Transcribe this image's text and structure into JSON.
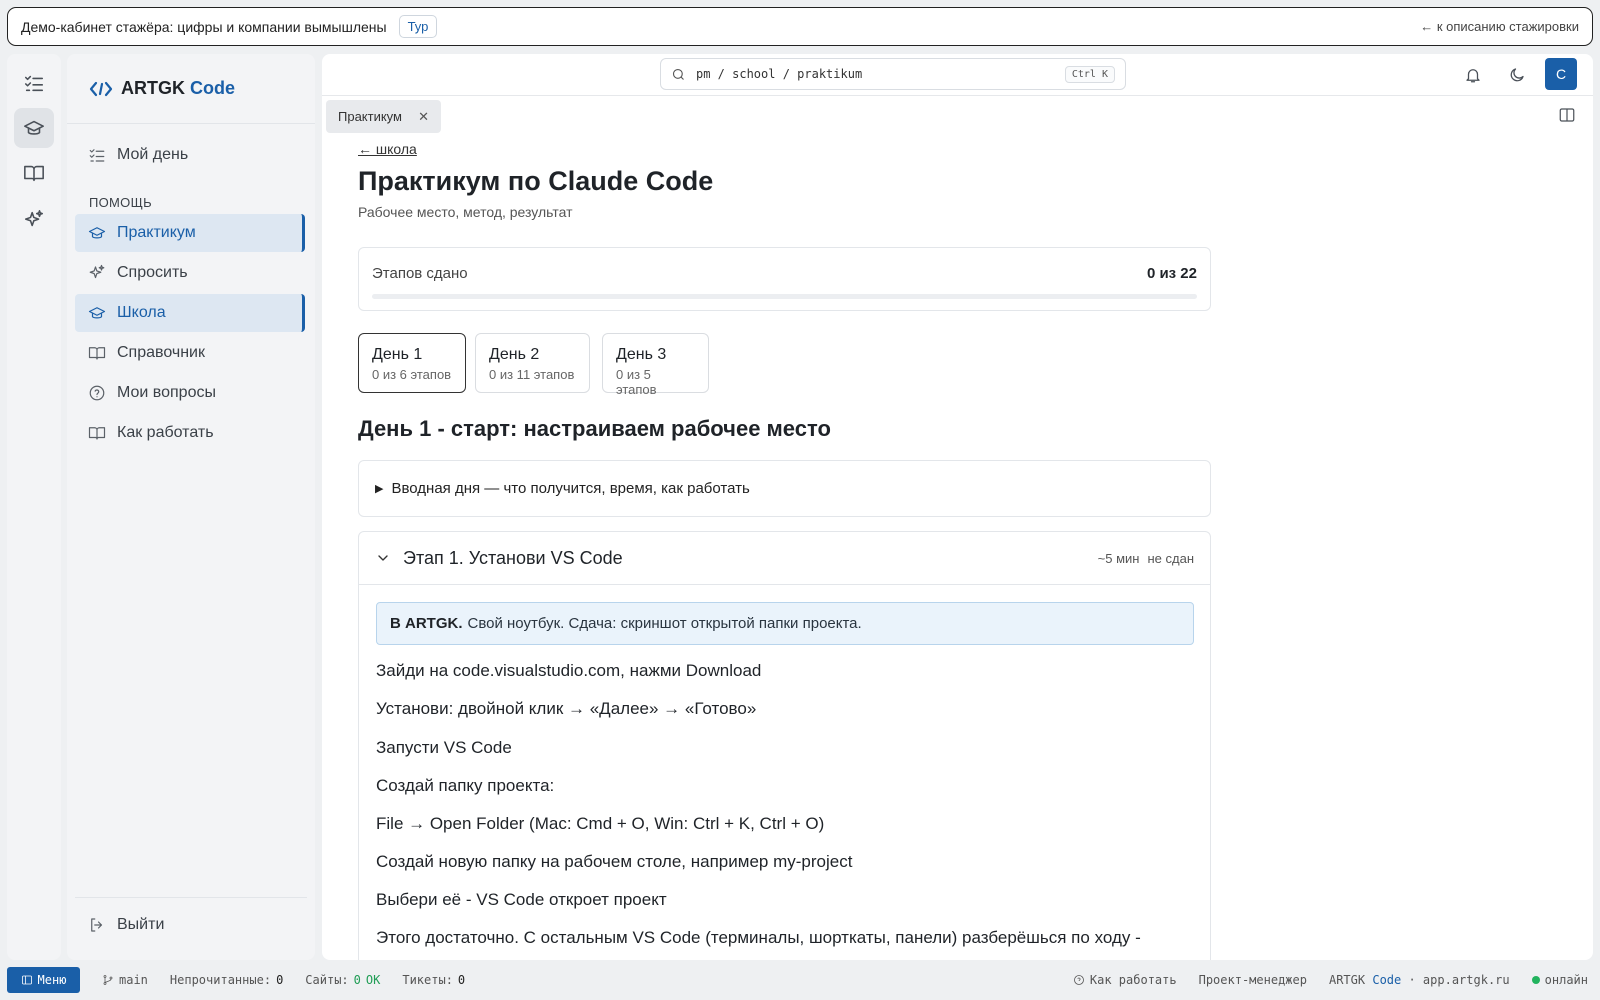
{
  "banner": {
    "text": "Демо-кабинет стажёра: цифры и компании вымышлены",
    "tour_label": "Тур",
    "back_label": "← к описанию стажировки"
  },
  "logo": {
    "name": "ARTGK",
    "accent": "Code"
  },
  "sidebar": {
    "section_label": "ПОМОЩЬ",
    "items": [
      {
        "label": "Мой день",
        "icon": "checklist-icon"
      },
      {
        "label": "Практикум",
        "icon": "graduation-cap-icon",
        "active": true
      },
      {
        "label": "Спросить",
        "icon": "sparkles-icon"
      },
      {
        "label": "Школа",
        "icon": "graduation-cap-icon",
        "active": true
      },
      {
        "label": "Справочник",
        "icon": "book-icon"
      },
      {
        "label": "Мои вопросы",
        "icon": "question-circle-icon"
      },
      {
        "label": "Как работать",
        "icon": "book-icon"
      }
    ],
    "logout_label": "Выйти"
  },
  "topbar": {
    "search_text": "pm / school / praktikum",
    "search_shortcut": "Ctrl K",
    "avatar_letter": "С"
  },
  "tab": {
    "label": "Практикум"
  },
  "page": {
    "back_link": "← школа",
    "title": "Практикум по Claude Code",
    "subtitle": "Рабочее место, метод, результат",
    "progress": {
      "label": "Этапов сдано",
      "value": "0 из 22",
      "fraction": 0
    }
  },
  "days": [
    {
      "title": "День 1",
      "sub": "0 из 6 этапов",
      "active": true
    },
    {
      "title": "День 2",
      "sub": "0 из 11 этапов"
    },
    {
      "title": "День 3",
      "sub": "0 из 5 этапов"
    }
  ],
  "day_heading": "День 1 - старт: настраиваем рабочее место",
  "intro": "Вводная дня — что получится, время, как работать",
  "stage": {
    "title": "Этап 1. Установи VS Code",
    "time": "~5 мин",
    "status": "не сдан",
    "callout_bold": "В ARTGK.",
    "callout_text": "Свой ноутбук. Сдача: скриншот открытой папки проекта.",
    "steps": [
      "Зайди на code.visualstudio.com, нажми Download",
      "Установи: двойной клик → «Далее» → «Готово»",
      "Запусти VS Code",
      "Создай папку проекта:",
      "File → Open Folder (Mac: Cmd + O, Win: Ctrl + K, Ctrl + O)",
      "Создай новую папку на рабочем столе, например my-project",
      "Выбери её - VS Code откроет проект",
      "Этого достаточно. С остальным VS Code (терминалы, шорткаты, панели) разберёшься по ходу -"
    ]
  },
  "statusbar": {
    "menu_label": "Меню",
    "branch": "main",
    "unread_label": "Непрочитанные:",
    "unread_value": "0",
    "sites_label": "Сайты:",
    "sites_value": "0",
    "sites_ok": "OK",
    "tickets_label": "Тикеты:",
    "tickets_value": "0",
    "help_label": "Как работать",
    "role_label": "Проект-менеджер",
    "brand_name": "ARTGK",
    "brand_accent": "Code",
    "domain": "· app.artgk.ru",
    "online_label": "онлайн"
  },
  "colors": {
    "accent": "#1a5fa8",
    "online": "#22b35e"
  }
}
